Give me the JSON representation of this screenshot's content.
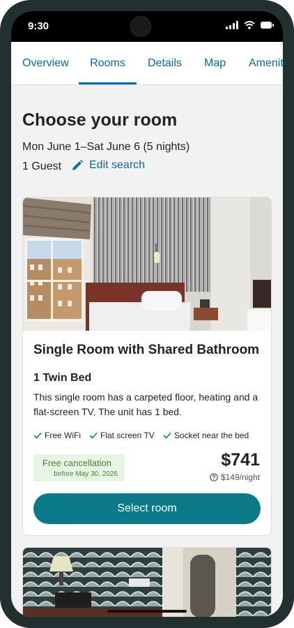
{
  "status_bar": {
    "time": "9:30"
  },
  "tabs": [
    {
      "label": "Overview",
      "active": false
    },
    {
      "label": "Rooms",
      "active": true
    },
    {
      "label": "Details",
      "active": false
    },
    {
      "label": "Map",
      "active": false
    },
    {
      "label": "Amenities",
      "active": false
    }
  ],
  "page": {
    "title": "Choose your room",
    "dates": "Mon June 1–Sat June 6 (5 nights)",
    "guests": "1 Guest",
    "edit_label": "Edit search"
  },
  "room": {
    "title": "Single Room with Shared Bathroom",
    "bed": "1 Twin Bed",
    "description": "This single room has a carpeted floor, heating and a flat-screen TV. The unit has 1 bed.",
    "features": [
      "Free WiFi",
      "Flat screen TV",
      "Socket near the bed"
    ],
    "cancellation": "Free cancellation",
    "cancellation_date": "before May 30, 2026",
    "price": "$741",
    "per_night": "$149/night",
    "select_label": "Select room"
  },
  "colors": {
    "accent": "#0a6aa8",
    "button": "#0b7a88",
    "cancel_bg": "#e8f4e5",
    "cancel_text": "#3c8a28"
  }
}
